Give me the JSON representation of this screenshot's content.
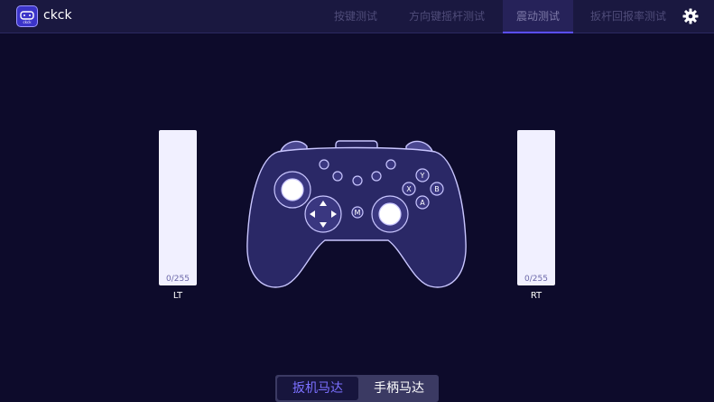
{
  "app": {
    "name": "ckck",
    "logo_text": "ckck"
  },
  "tabs": [
    {
      "label": "按键测试",
      "active": false
    },
    {
      "label": "方向键摇杆测试",
      "active": false
    },
    {
      "label": "震动测试",
      "active": true
    },
    {
      "label": "扳杆回报率测试",
      "active": false
    }
  ],
  "triggers": {
    "left": {
      "value": "0/255",
      "label": "LT",
      "level": 0
    },
    "right": {
      "value": "0/255",
      "label": "RT",
      "level": 0
    }
  },
  "controller": {
    "buttons": {
      "y": "Y",
      "x": "X",
      "b": "B",
      "a": "A",
      "m": "M"
    }
  },
  "motor_toggle": {
    "options": [
      "扳机马达",
      "手柄马达"
    ],
    "selected": "扳机马达"
  },
  "colors": {
    "background": "#0d0b2b",
    "topbar": "#1a1840",
    "accent": "#5a4fff",
    "controller_outline": "#c9c6ff"
  }
}
